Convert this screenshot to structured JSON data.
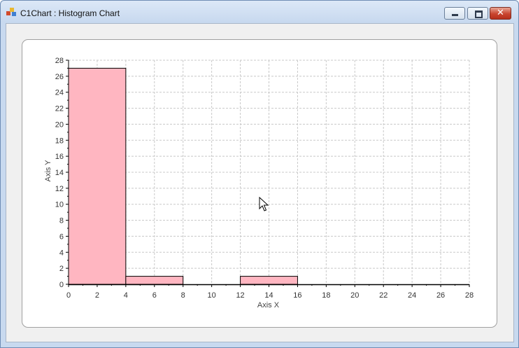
{
  "window": {
    "title": "C1Chart : Histogram Chart",
    "close_glyph": "✕",
    "icons": [
      "app-icon",
      "minimize-icon",
      "maximize-icon",
      "close-icon",
      "mouse-cursor-icon"
    ]
  },
  "chart_data": {
    "type": "bar",
    "histogram": true,
    "bins": [
      {
        "x0": 0,
        "x1": 4,
        "count": 27
      },
      {
        "x0": 4,
        "x1": 8,
        "count": 1
      },
      {
        "x0": 8,
        "x1": 12,
        "count": 0
      },
      {
        "x0": 12,
        "x1": 16,
        "count": 1
      },
      {
        "x0": 16,
        "x1": 20,
        "count": 0
      },
      {
        "x0": 20,
        "x1": 24,
        "count": 0
      },
      {
        "x0": 24,
        "x1": 28,
        "count": 0
      }
    ],
    "xlabel": "Axis X",
    "ylabel": "Axis Y",
    "xlim": [
      0,
      28
    ],
    "ylim": [
      0,
      28
    ],
    "x_ticks": [
      "0",
      "2",
      "4",
      "6",
      "8",
      "10",
      "12",
      "14",
      "16",
      "18",
      "20",
      "22",
      "24",
      "26",
      "28"
    ],
    "y_ticks": [
      "0",
      "2",
      "4",
      "6",
      "8",
      "10",
      "12",
      "14",
      "16",
      "18",
      "20",
      "22",
      "24",
      "26",
      "28"
    ],
    "grid": true,
    "bar_color": "#ffb6c1",
    "bar_edge_color": "#000000"
  }
}
